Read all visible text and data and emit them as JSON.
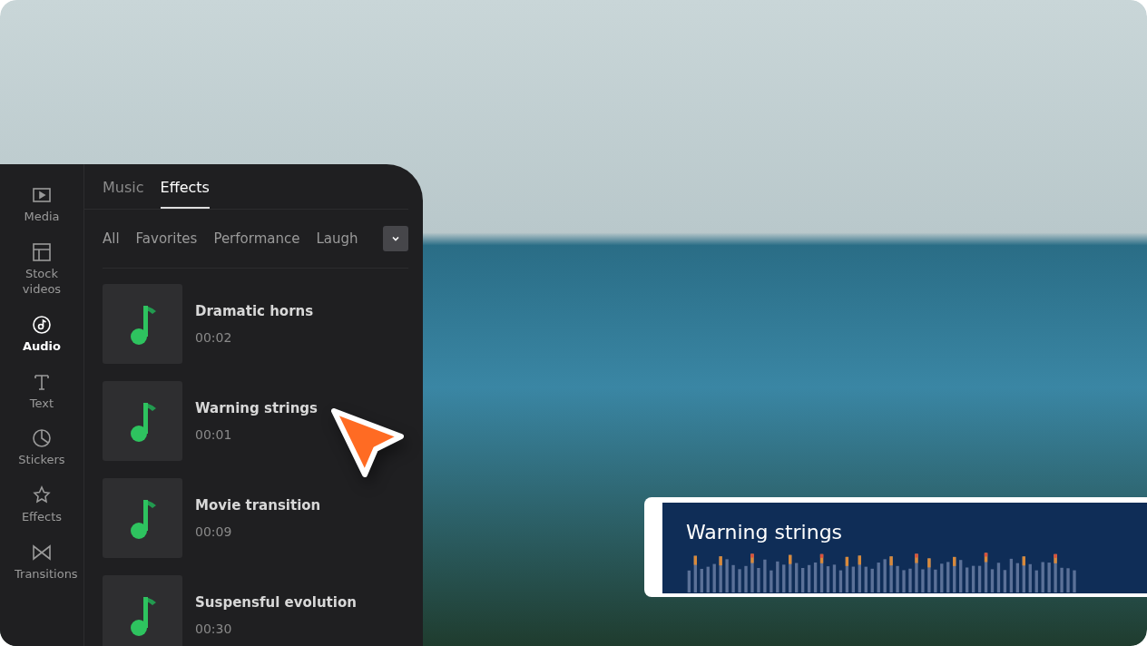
{
  "sidebar": {
    "items": [
      {
        "label": "Media",
        "selected": false
      },
      {
        "label": "Stock videos",
        "selected": false
      },
      {
        "label": "Audio",
        "selected": true
      },
      {
        "label": "Text",
        "selected": false
      },
      {
        "label": "Stickers",
        "selected": false
      },
      {
        "label": "Effects",
        "selected": false
      },
      {
        "label": "Transitions",
        "selected": false
      }
    ]
  },
  "tabs": [
    {
      "label": "Music",
      "selected": false
    },
    {
      "label": "Effects",
      "selected": true
    }
  ],
  "filters": [
    "All",
    "Favorites",
    "Performance",
    "Laugh"
  ],
  "tracks": [
    {
      "title": "Dramatic horns",
      "duration": "00:02"
    },
    {
      "title": "Warning strings",
      "duration": "00:01"
    },
    {
      "title": "Movie transition",
      "duration": "00:09"
    },
    {
      "title": "Suspensful evolution",
      "duration": "00:30"
    }
  ],
  "timeline_clip": {
    "title": "Warning strings"
  }
}
